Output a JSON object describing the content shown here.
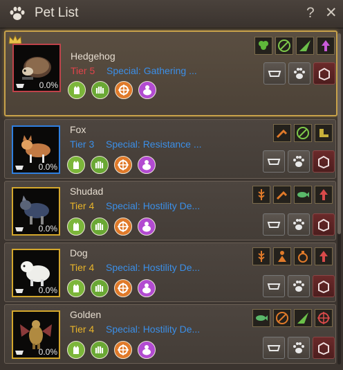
{
  "window": {
    "title": "Pet List",
    "help_label": "?",
    "close_label": "✕"
  },
  "pets": [
    {
      "name": "Hedgehog",
      "tier": "Tier 5",
      "tier_color": "#e0434a",
      "special": "Special: Gathering ...",
      "hunger": "0.0%",
      "selected": true
    },
    {
      "name": "Fox",
      "tier": "Tier 3",
      "tier_color": "#3b8fe8",
      "special": "Special: Resistance ...",
      "hunger": "0.0%",
      "selected": false
    },
    {
      "name": "Shudad",
      "tier": "Tier 4",
      "tier_color": "#e8b42a",
      "special": "Special: Hostility De...",
      "hunger": "0.0%",
      "selected": false
    },
    {
      "name": "Dog",
      "tier": "Tier 4",
      "tier_color": "#e8b42a",
      "special": "Special: Hostility De...",
      "hunger": "0.0%",
      "selected": false
    },
    {
      "name": "Golden",
      "tier": "Tier 4",
      "tier_color": "#e8b42a",
      "special": "Special: Hostility De...",
      "hunger": "0.0%",
      "selected": false
    }
  ],
  "icons": {
    "status": [
      "cat-icon",
      "hand-icon",
      "compass-icon",
      "bag-icon"
    ],
    "actions": [
      "feed-bowl-icon",
      "paw-icon",
      "box-icon"
    ]
  }
}
